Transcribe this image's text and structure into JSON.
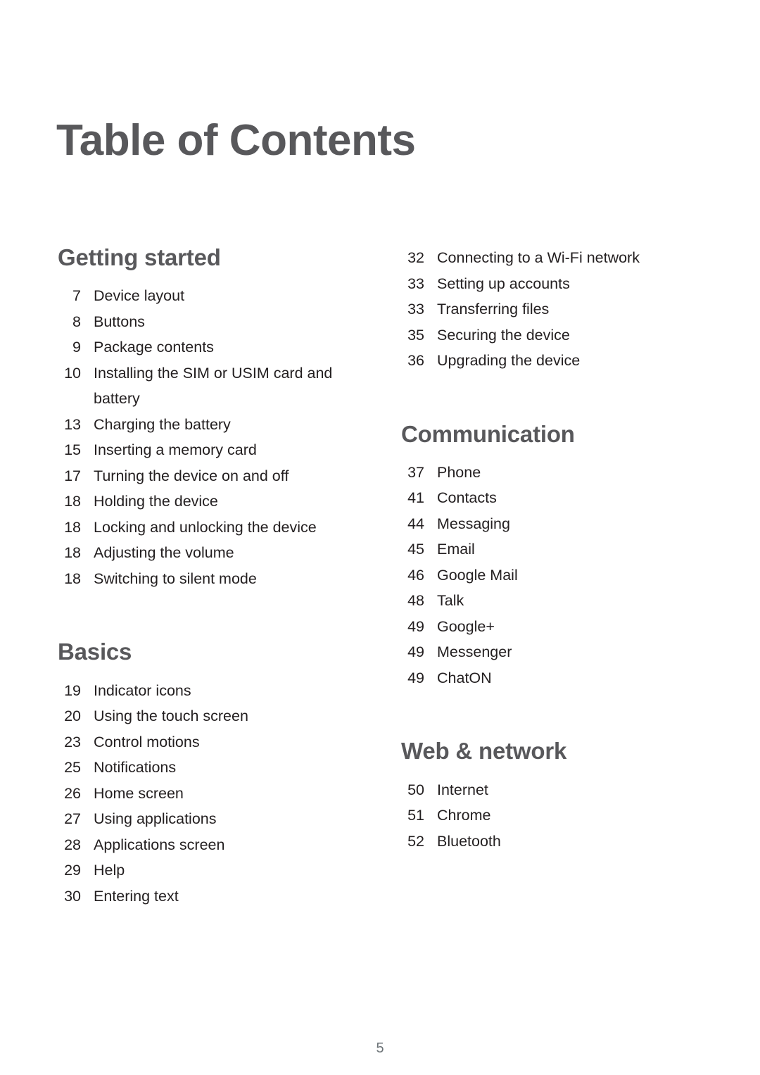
{
  "document": {
    "title": "Table of Contents",
    "folio": "5"
  },
  "columns": [
    {
      "name": "left",
      "sections": [
        {
          "heading": "Getting started",
          "has_heading": true,
          "entries": [
            {
              "page": "7",
              "label": "Device layout"
            },
            {
              "page": "8",
              "label": "Buttons"
            },
            {
              "page": "9",
              "label": "Package contents"
            },
            {
              "page": "10",
              "label": "Installing the SIM or USIM card and battery"
            },
            {
              "page": "13",
              "label": "Charging the battery"
            },
            {
              "page": "15",
              "label": "Inserting a memory card"
            },
            {
              "page": "17",
              "label": "Turning the device on and off"
            },
            {
              "page": "18",
              "label": "Holding the device"
            },
            {
              "page": "18",
              "label": "Locking and unlocking the device"
            },
            {
              "page": "18",
              "label": "Adjusting the volume"
            },
            {
              "page": "18",
              "label": "Switching to silent mode"
            }
          ]
        },
        {
          "heading": "Basics",
          "has_heading": true,
          "entries": [
            {
              "page": "19",
              "label": "Indicator icons"
            },
            {
              "page": "20",
              "label": "Using the touch screen"
            },
            {
              "page": "23",
              "label": "Control motions"
            },
            {
              "page": "25",
              "label": "Notifications"
            },
            {
              "page": "26",
              "label": "Home screen"
            },
            {
              "page": "27",
              "label": "Using applications"
            },
            {
              "page": "28",
              "label": "Applications screen"
            },
            {
              "page": "29",
              "label": "Help"
            },
            {
              "page": "30",
              "label": "Entering text"
            }
          ]
        }
      ]
    },
    {
      "name": "right",
      "sections": [
        {
          "heading": "",
          "has_heading": false,
          "entries": [
            {
              "page": "32",
              "label": "Connecting to a Wi-Fi network"
            },
            {
              "page": "33",
              "label": "Setting up accounts"
            },
            {
              "page": "33",
              "label": "Transferring files"
            },
            {
              "page": "35",
              "label": "Securing the device"
            },
            {
              "page": "36",
              "label": "Upgrading the device"
            }
          ]
        },
        {
          "heading": "Communication",
          "has_heading": true,
          "entries": [
            {
              "page": "37",
              "label": "Phone"
            },
            {
              "page": "41",
              "label": "Contacts"
            },
            {
              "page": "44",
              "label": "Messaging"
            },
            {
              "page": "45",
              "label": "Email"
            },
            {
              "page": "46",
              "label": "Google Mail"
            },
            {
              "page": "48",
              "label": "Talk"
            },
            {
              "page": "49",
              "label": "Google+"
            },
            {
              "page": "49",
              "label": "Messenger"
            },
            {
              "page": "49",
              "label": "ChatON"
            }
          ]
        },
        {
          "heading": "Web & network",
          "has_heading": true,
          "entries": [
            {
              "page": "50",
              "label": "Internet"
            },
            {
              "page": "51",
              "label": "Chrome"
            },
            {
              "page": "52",
              "label": "Bluetooth"
            }
          ]
        }
      ]
    }
  ]
}
